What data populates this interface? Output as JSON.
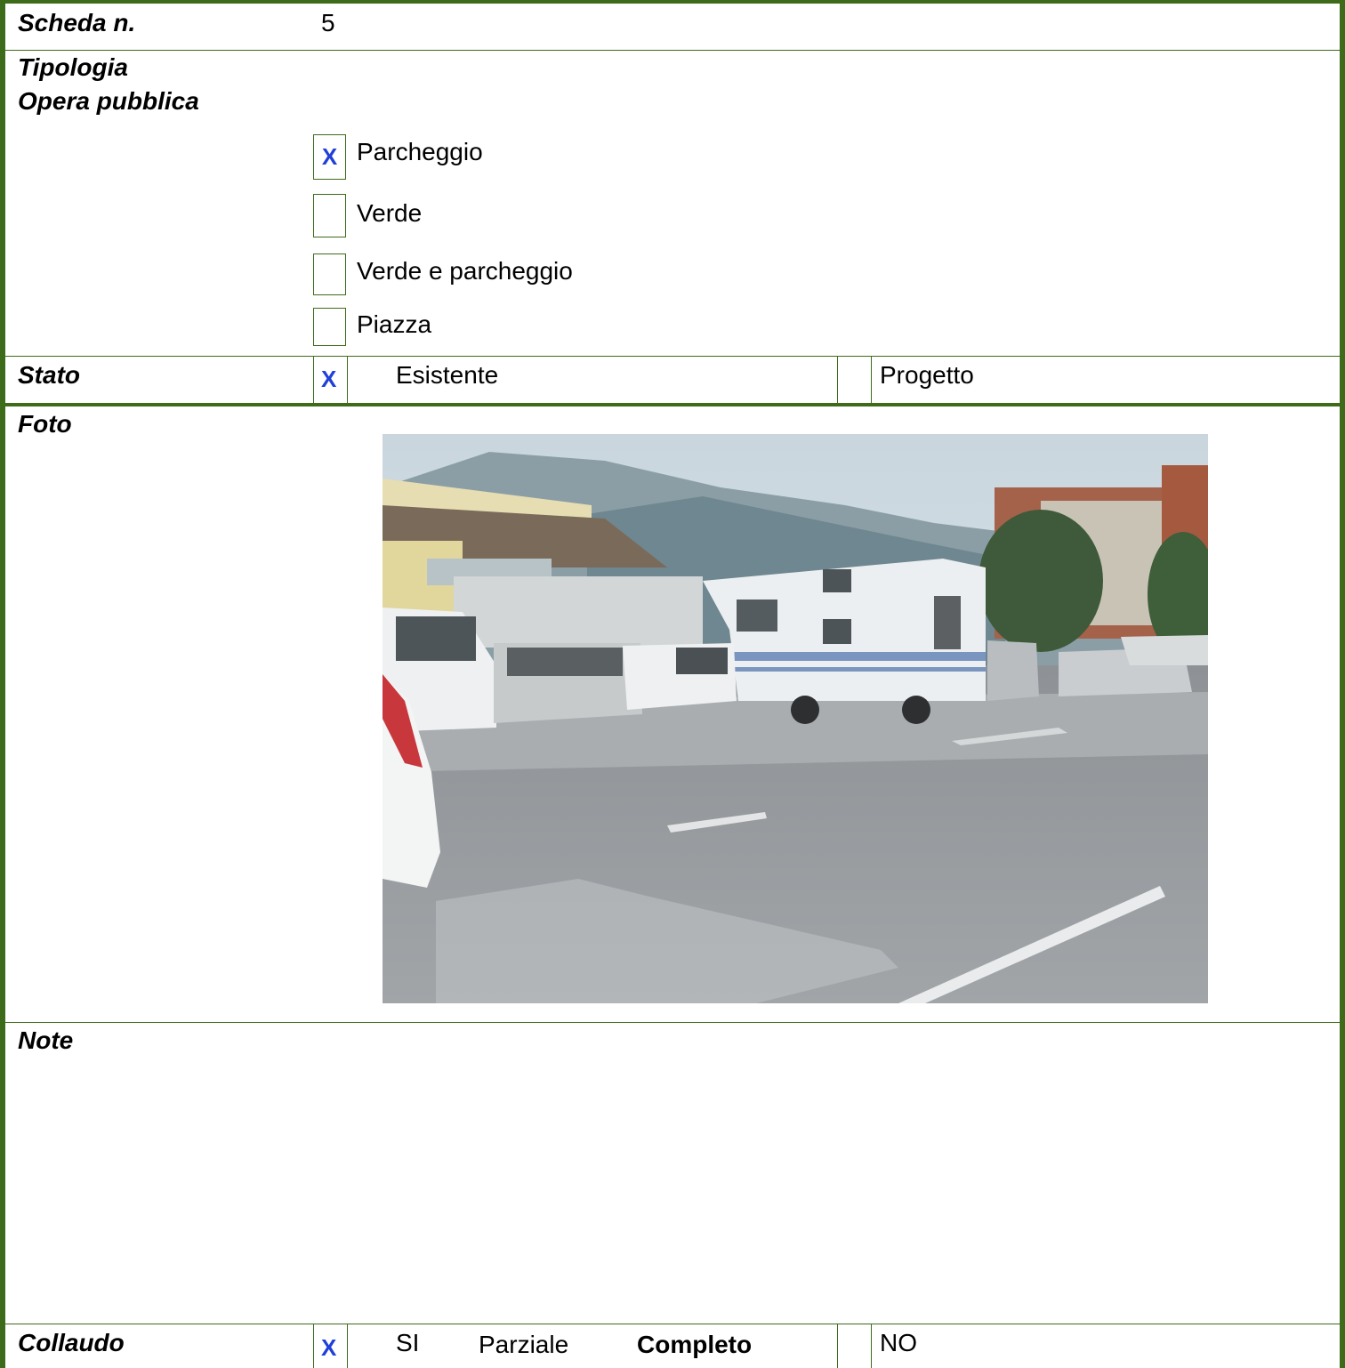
{
  "scheda": {
    "label": "Scheda n.",
    "value": "5"
  },
  "tipologia": {
    "label1": "Tipologia",
    "label2": "Opera pubblica",
    "options": [
      {
        "label": "Parcheggio",
        "checked": true,
        "mark": "X"
      },
      {
        "label": "Verde",
        "checked": false,
        "mark": ""
      },
      {
        "label": "Verde e parcheggio",
        "checked": false,
        "mark": ""
      },
      {
        "label": "Piazza",
        "checked": false,
        "mark": ""
      }
    ]
  },
  "stato": {
    "label": "Stato",
    "mark": "X",
    "option1": "Esistente",
    "option2": "Progetto"
  },
  "foto": {
    "label": "Foto"
  },
  "note": {
    "label": "Note"
  },
  "collaudo": {
    "label": "Collaudo",
    "mark": "X",
    "si": "SI",
    "parziale": "Parziale",
    "completo": "Completo",
    "no": "NO"
  }
}
